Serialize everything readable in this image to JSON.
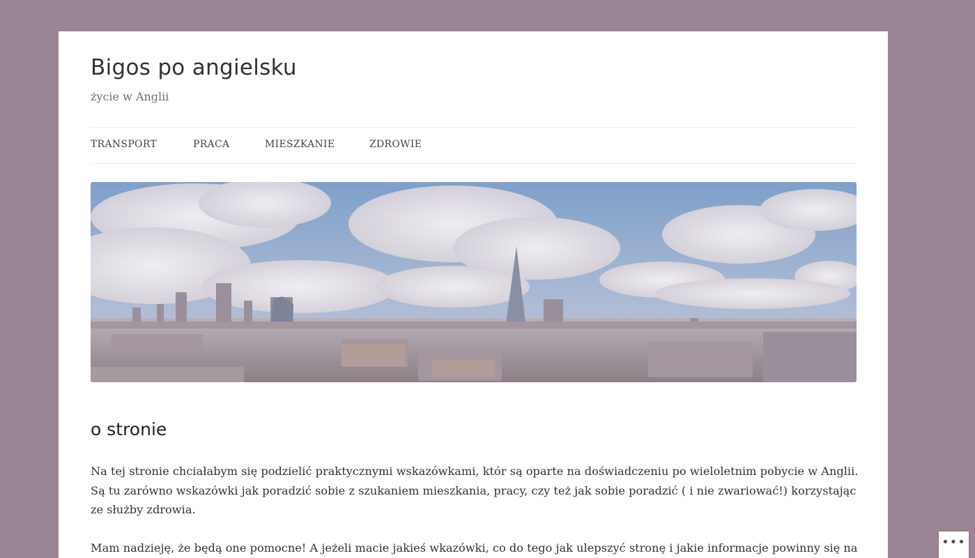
{
  "site": {
    "title": "Bigos po angielsku",
    "tagline": "życie w Anglii"
  },
  "nav": {
    "items": [
      {
        "label": "TRANSPORT"
      },
      {
        "label": "PRACA"
      },
      {
        "label": "MIESZKANIE"
      },
      {
        "label": "ZDROWIE"
      }
    ]
  },
  "hero": {
    "description": "London skyline panorama with The Shard"
  },
  "content": {
    "heading": "o stronie",
    "paragraphs": [
      "Na tej stronie chciałabym się podzielić praktycznymi wskazówkami, któr są oparte na doświadczeniu po wieloletnim pobycie w Anglii. Są tu zarówno wskazówki jak poradzić sobie z szukaniem mieszkania, pracy, czy też jak sobie poradzić ( i nie zwariować!) korzystając ze służby zdrowia.",
      "Mam nadzieję, że będą one pomocne! A jeżeli macie jakieś wkazówki, co do tego jak ulepszyć stronę i jakie informacje powinny się na"
    ]
  },
  "actions": {
    "more_icon": "more-horizontal-icon",
    "more_glyph": "•••"
  },
  "colors": {
    "background": "#9b8594",
    "page": "#ffffff",
    "text": "#333333"
  }
}
